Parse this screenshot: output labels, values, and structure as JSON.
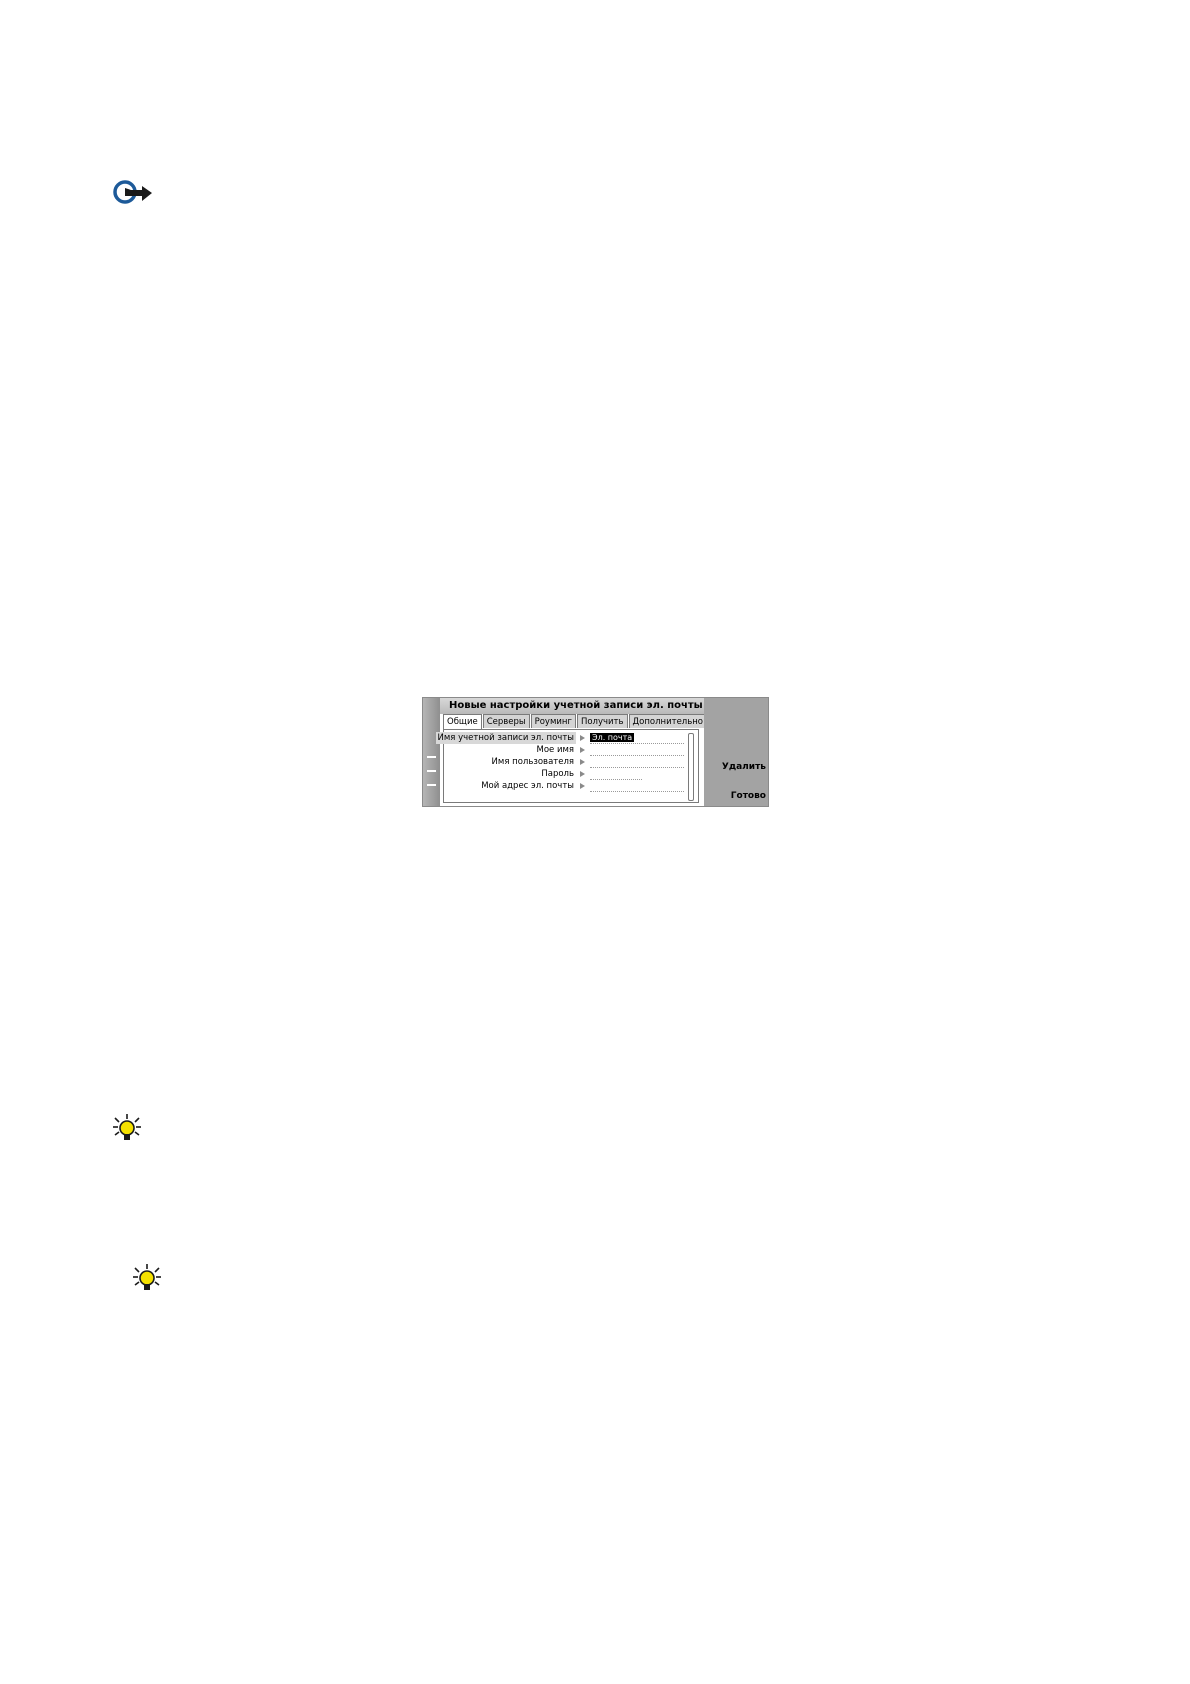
{
  "icons": {
    "important": "important-pointing-hand-icon",
    "tip1": "tip-lightbulb-icon",
    "tip2": "tip-lightbulb-icon"
  },
  "window": {
    "title": "Новые настройки учетной записи эл. почты"
  },
  "tabs": [
    {
      "label": "Общие",
      "active": true
    },
    {
      "label": "Серверы",
      "active": false
    },
    {
      "label": "Роуминг",
      "active": false
    },
    {
      "label": "Получить",
      "active": false
    },
    {
      "label": "Дополнительно",
      "active": false
    }
  ],
  "settings": [
    {
      "label": "Имя учетной записи эл. почты",
      "value": "Эл. почта",
      "selected": true
    },
    {
      "label": "Мое имя",
      "value": ""
    },
    {
      "label": "Имя пользователя",
      "value": ""
    },
    {
      "label": "Пароль",
      "value": ""
    },
    {
      "label": "Мой адрес эл. почты",
      "value": ""
    }
  ],
  "commands": {
    "delete": "Удалить",
    "done": "Готово"
  },
  "colors": {
    "title_bar": "#c8c8c8",
    "command_area": "#a3a3a3",
    "tip_bulb": "#f5e100",
    "important_icon_blue": "#1d5a99"
  }
}
